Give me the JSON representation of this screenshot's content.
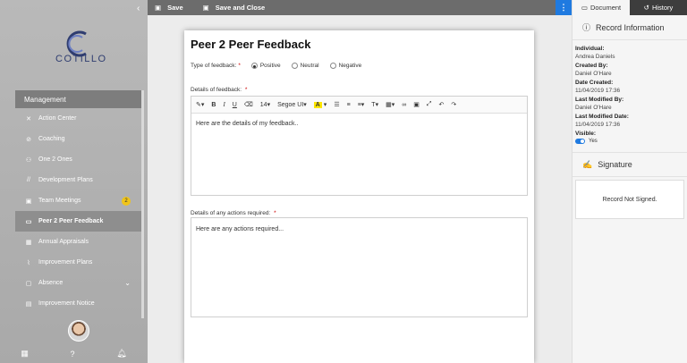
{
  "sidebar": {
    "logo_text": "COTILLO",
    "menu_header": "Management",
    "items": [
      {
        "label": "Action Center",
        "icon": "crosshair-icon"
      },
      {
        "label": "Coaching",
        "icon": "compass-icon"
      },
      {
        "label": "One 2 Ones",
        "icon": "people-icon"
      },
      {
        "label": "Development Plans",
        "icon": "path-icon"
      },
      {
        "label": "Team Meetings",
        "icon": "meeting-icon",
        "badge": "2"
      },
      {
        "label": "Peer 2 Peer Feedback",
        "icon": "chat-icon",
        "active": true
      },
      {
        "label": "Annual Appraisals",
        "icon": "calendar-icon"
      },
      {
        "label": "Improvement Plans",
        "icon": "chart-icon"
      },
      {
        "label": "Absence",
        "icon": "box-icon",
        "expandable": true
      },
      {
        "label": "Improvement Notice",
        "icon": "document-icon"
      }
    ],
    "footer_icons": [
      "grid-icon",
      "help-icon",
      "bell-icon"
    ]
  },
  "topbar": {
    "save_label": "Save",
    "save_close_label": "Save and Close"
  },
  "document": {
    "title": "Peer 2 Peer Feedback",
    "type_label": "Type of feedback:",
    "required_mark": "*",
    "type_options": [
      "Positive",
      "Neutral",
      "Negative"
    ],
    "type_selected": "Positive",
    "details_label": "Details of feedback:",
    "details_text": "Here are the details of my feedback..",
    "actions_label": "Details of any actions required:",
    "actions_text": "Here are any actions required...",
    "toolbar": {
      "font_size": "14",
      "font_family": "Segoe UI",
      "highlight_letter": "A"
    }
  },
  "right_panel": {
    "tabs": [
      "Document",
      "History"
    ],
    "active_tab": "Document",
    "record_info_title": "Record Information",
    "fields": [
      {
        "label": "Individual:",
        "value": "Andrea Daniels"
      },
      {
        "label": "Created By:",
        "value": "Daniel O'Hare"
      },
      {
        "label": "Date Created:",
        "value": "11/04/2019 17:36"
      },
      {
        "label": "Last Modified By:",
        "value": "Daniel O'Hare"
      },
      {
        "label": "Last Modified Date:",
        "value": "11/04/2019 17:36"
      }
    ],
    "visible_label": "Visible:",
    "visible_value": "Yes",
    "signature_title": "Signature",
    "signature_status": "Record Not Signed."
  }
}
